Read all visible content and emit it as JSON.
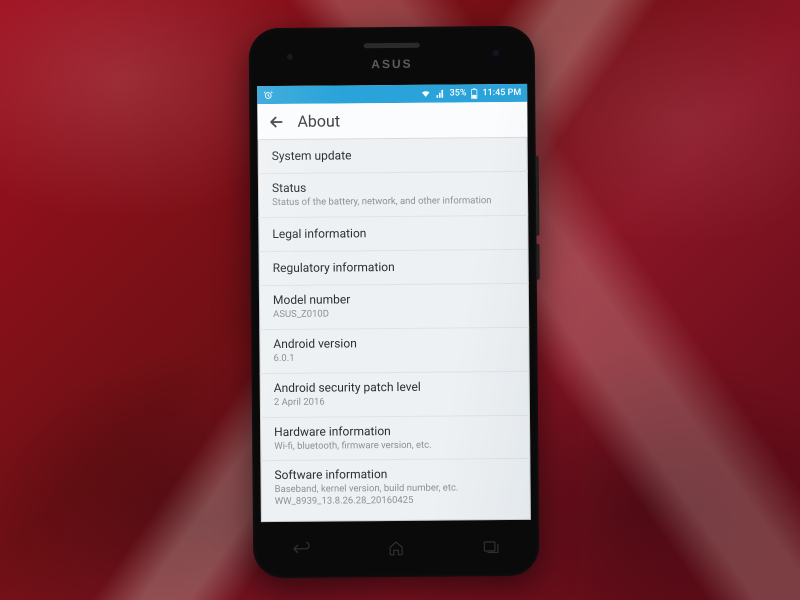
{
  "phone": {
    "brand": "ASUS"
  },
  "statusbar": {
    "battery_pct": "35%",
    "time": "11:45 PM"
  },
  "appbar": {
    "title": "About"
  },
  "rows": [
    {
      "title": "System update",
      "sub": null
    },
    {
      "title": "Status",
      "sub": "Status of the battery, network, and other information"
    },
    {
      "title": "Legal information",
      "sub": null
    },
    {
      "title": "Regulatory information",
      "sub": null
    },
    {
      "title": "Model number",
      "sub": "ASUS_Z010D"
    },
    {
      "title": "Android version",
      "sub": "6.0.1"
    },
    {
      "title": "Android security patch level",
      "sub": "2 April 2016"
    },
    {
      "title": "Hardware information",
      "sub": "Wi-fi, bluetooth, firmware version, etc."
    },
    {
      "title": "Software information",
      "sub": "Baseband, kernel version, build number, etc.\nWW_8939_13.8.26.28_20160425"
    }
  ]
}
